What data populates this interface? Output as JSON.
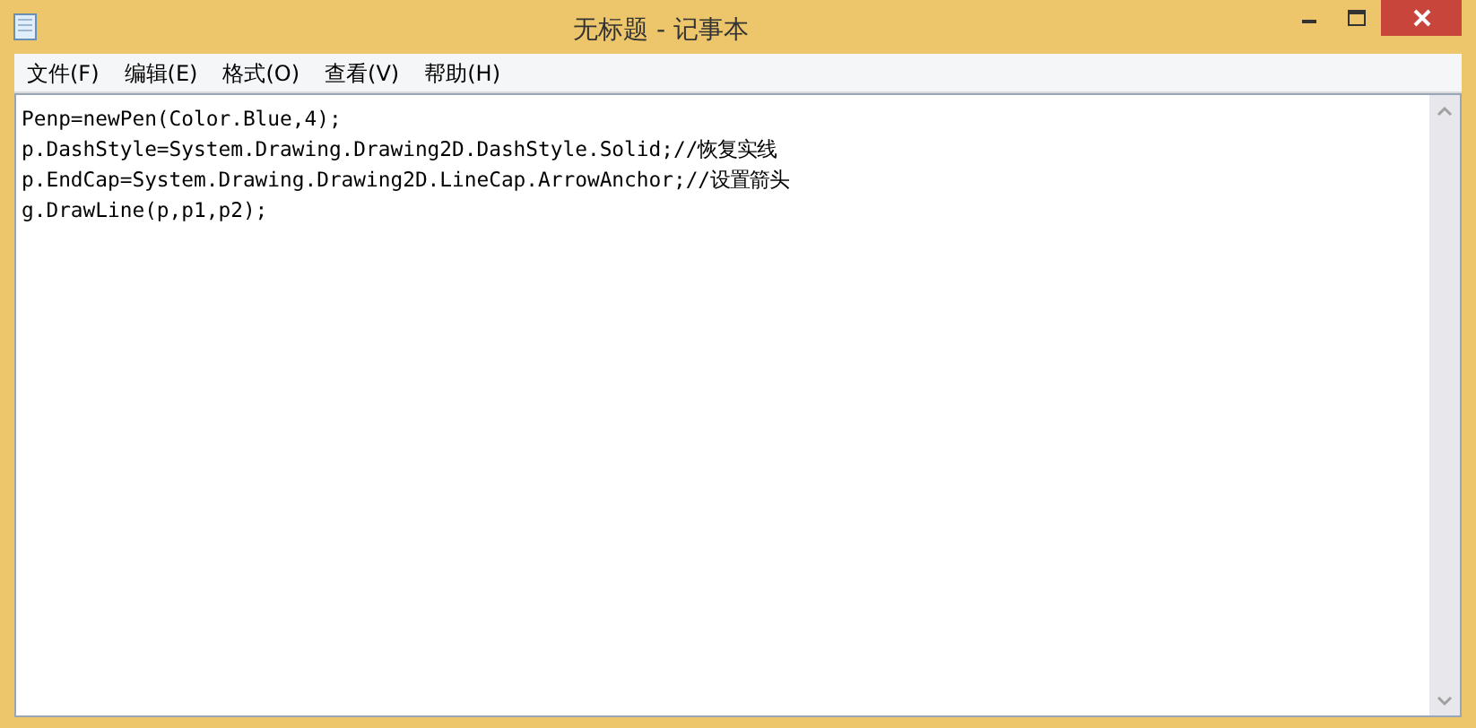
{
  "window": {
    "title": "无标题 - 记事本"
  },
  "menu": [
    {
      "label": "文件(F)"
    },
    {
      "label": "编辑(E)"
    },
    {
      "label": "格式(O)"
    },
    {
      "label": "查看(V)"
    },
    {
      "label": "帮助(H)"
    }
  ],
  "editor": {
    "lines": [
      "Penp=newPen(Color.Blue,4);",
      "p.DashStyle=System.Drawing.Drawing2D.DashStyle.Solid;//恢复实线",
      "p.EndCap=System.Drawing.Drawing2D.LineCap.ArrowAnchor;//设置箭头",
      "g.DrawLine(p,p1,p2);"
    ]
  }
}
